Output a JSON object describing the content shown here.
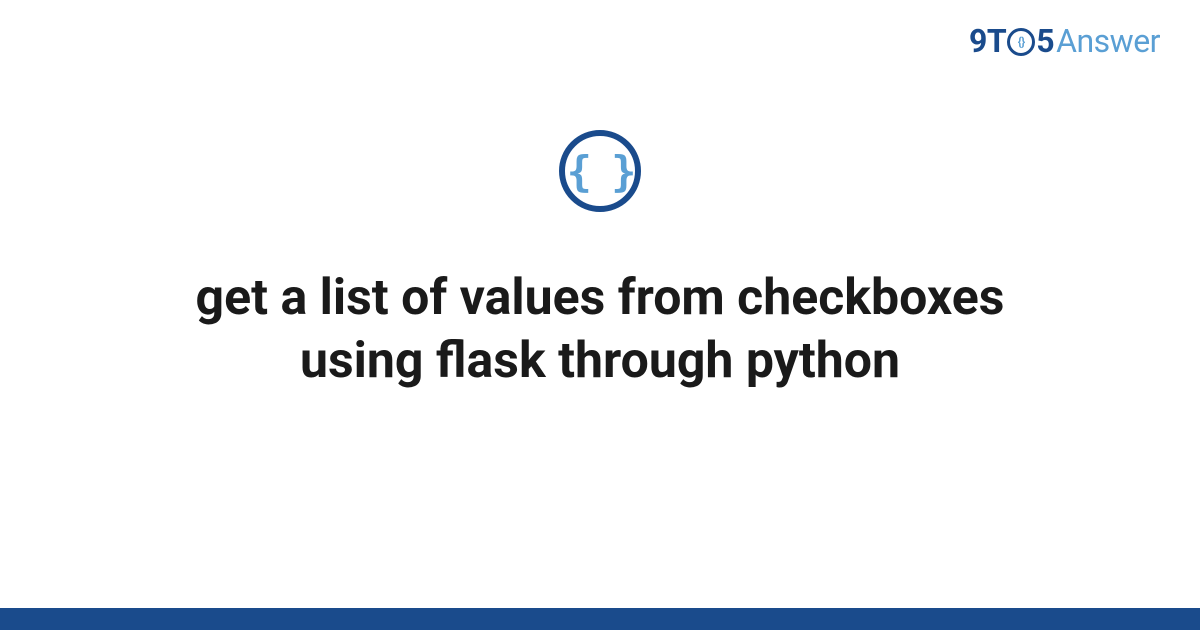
{
  "brand": {
    "prefix": "9T",
    "circle_inner": "{}",
    "suffix": "5",
    "word": "Answer"
  },
  "icon": {
    "glyph": "{ }"
  },
  "main": {
    "title": "get a list of values from checkboxes using flask through python"
  },
  "colors": {
    "primary": "#1a4b8c",
    "accent": "#5a9fd4",
    "text": "#1a1a1a",
    "background": "#ffffff"
  }
}
